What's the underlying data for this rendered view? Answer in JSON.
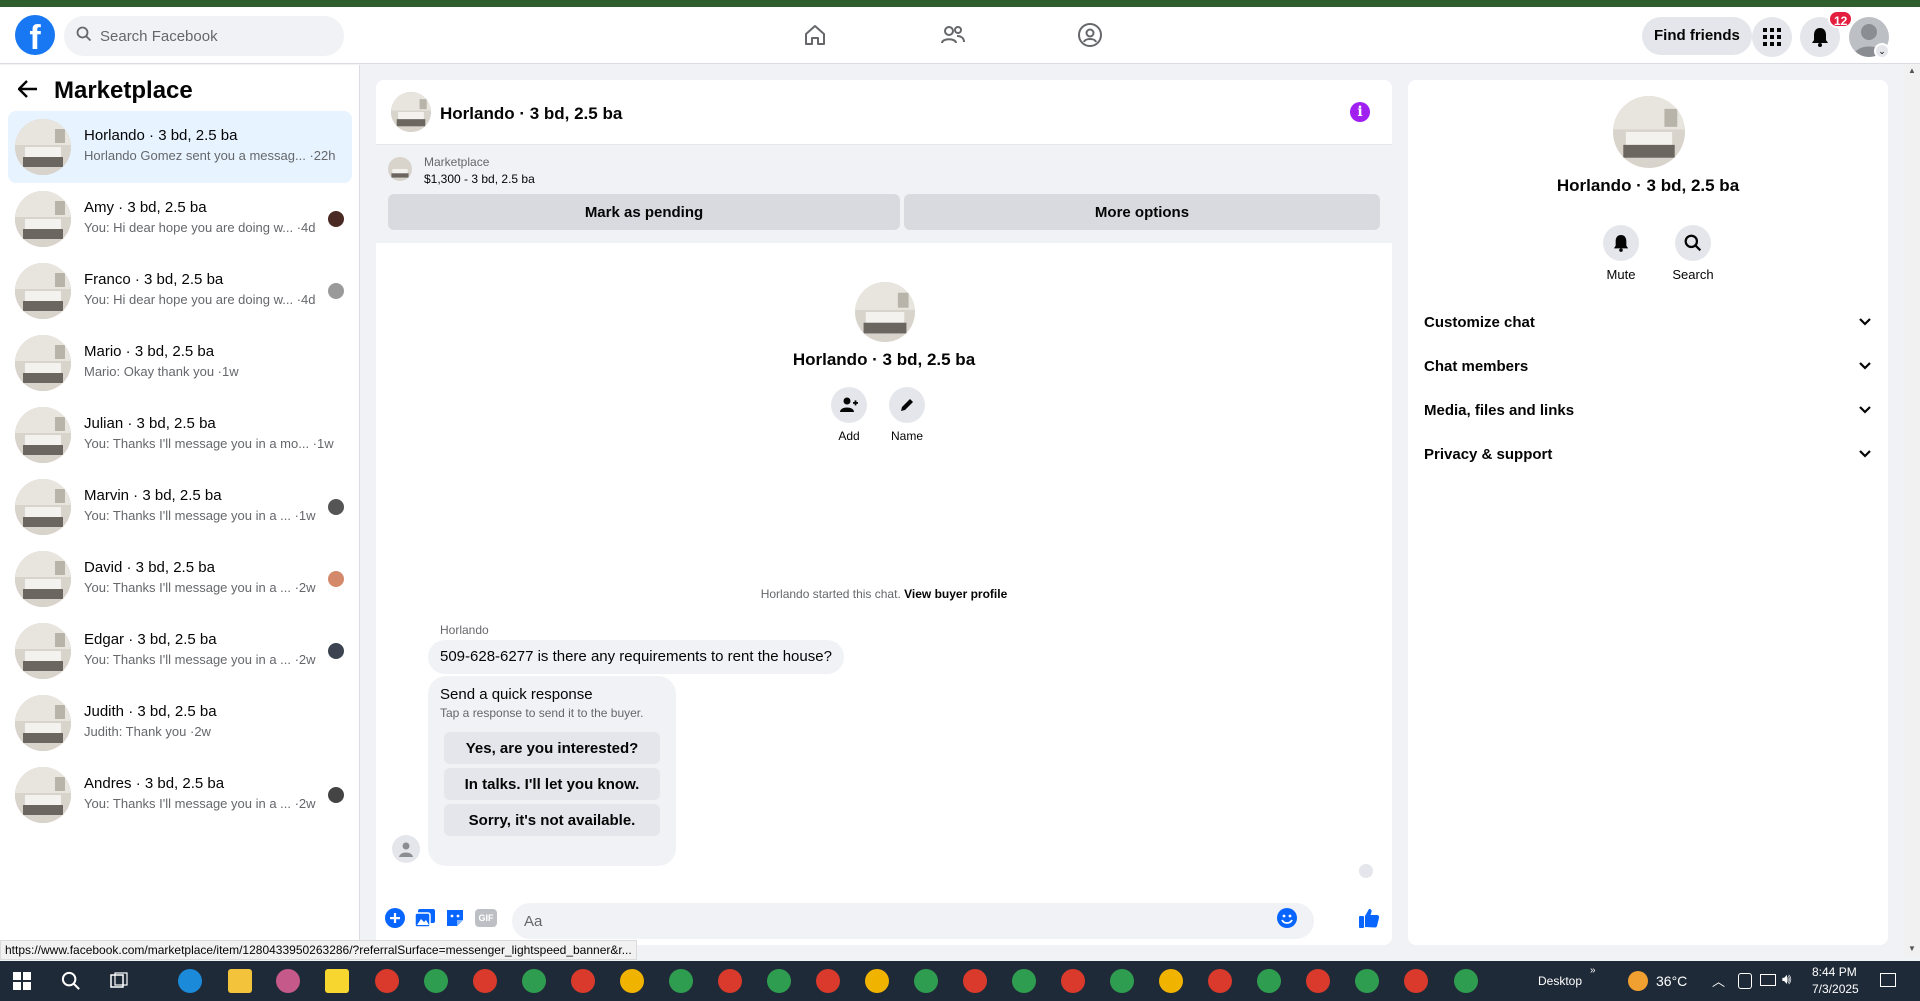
{
  "header": {
    "logo_letter": "f",
    "search_placeholder": "Search Facebook",
    "find_friends_label": "Find friends",
    "notification_count": "12"
  },
  "sidebar": {
    "title": "Marketplace",
    "conversations": [
      {
        "name": "Horlando · 3 bd, 2.5 ba",
        "snippet": "Horlando Gomez sent you a messag... ·22h",
        "active": true
      },
      {
        "name": "Amy · 3 bd, 2.5 ba",
        "snippet": "You: Hi dear hope you are doing w... ·4d"
      },
      {
        "name": "Franco · 3 bd, 2.5 ba",
        "snippet": "You: Hi dear hope you are doing w... ·4d"
      },
      {
        "name": "Mario · 3 bd, 2.5 ba",
        "snippet": "Mario: Okay thank you ·1w"
      },
      {
        "name": "Julian · 3 bd, 2.5 ba",
        "snippet": "You: Thanks I'll message you in a mo... ·1w"
      },
      {
        "name": "Marvin · 3 bd, 2.5 ba",
        "snippet": "You: Thanks I'll message you in a ... ·1w"
      },
      {
        "name": "David · 3 bd, 2.5 ba",
        "snippet": "You: Thanks I'll message you in a ... ·2w"
      },
      {
        "name": "Edgar · 3 bd, 2.5 ba",
        "snippet": "You: Thanks I'll message you in a ... ·2w"
      },
      {
        "name": "Judith · 3 bd, 2.5 ba",
        "snippet": "Judith: Thank you ·2w"
      },
      {
        "name": "Andres · 3 bd, 2.5 ba",
        "snippet": "You: Thanks I'll message you in a ... ·2w"
      }
    ]
  },
  "chat": {
    "title": "Horlando · 3 bd, 2.5 ba",
    "marketplace_label": "Marketplace",
    "listing": "$1,300 - 3 bd, 2.5 ba",
    "mark_pending": "Mark as pending",
    "more_options": "More options",
    "center_name": "Horlando · 3 bd, 2.5 ba",
    "add_label": "Add",
    "name_label": "Name",
    "started_text": "Horlando started this chat.",
    "buyer_profile_link": "View buyer profile",
    "sender": "Horlando",
    "message": "509-628-6277 is there any requirements to rent the house?",
    "quick_title": "Send a quick response",
    "quick_subtitle": "Tap a response to send it to the buyer.",
    "quick_responses": [
      "Yes, are you interested?",
      "In talks. I'll let you know.",
      "Sorry, it's not available."
    ],
    "composer_placeholder": "Aa",
    "gif_label": "GIF"
  },
  "right_panel": {
    "name": "Horlando · 3 bd, 2.5 ba",
    "mute_label": "Mute",
    "search_label": "Search",
    "sections": [
      "Customize chat",
      "Chat members",
      "Media, files and links",
      "Privacy & support"
    ]
  },
  "status_url": "https://www.facebook.com/marketplace/item/1280433950263286/?referralSurface=messenger_lightspeed_banner&r...",
  "taskbar": {
    "desktop_label": "Desktop",
    "temperature": "36°C",
    "time": "8:44 PM",
    "date": "7/3/2025"
  },
  "colors": {
    "brand": "#1877f2",
    "active_conv": "#e7f3ff",
    "badge": "#e41e3f",
    "info": "#a020f0",
    "taskbar": "#1f2a38"
  }
}
